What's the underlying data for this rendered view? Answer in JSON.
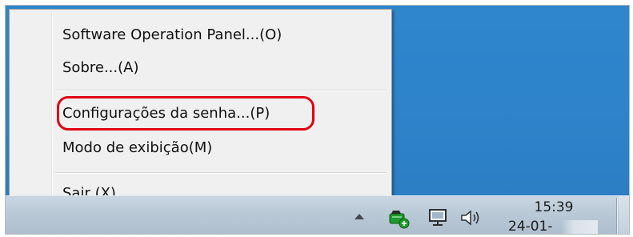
{
  "context_menu": {
    "items": [
      {
        "label": "Software Operation Panel...(O)"
      },
      {
        "label": "Sobre...(A)"
      },
      {
        "label": "Configurações da senha...(P)"
      },
      {
        "label": "Modo de exibição(M)"
      },
      {
        "label": "Sair (X)"
      }
    ],
    "highlighted_item": "Configurações da senha...(P)",
    "highlight_color": "#e00015"
  },
  "taskbar": {
    "tray_icons": [
      "show-hidden-icons-arrow",
      "scanner-icon",
      "network-icon",
      "volume-icon"
    ],
    "clock": {
      "time": "15:39",
      "date": "24-01-"
    }
  },
  "colors": {
    "desktop": "#2e83ca",
    "menu_background": "#f0f0f0",
    "taskbar": "#b9c8d6",
    "scanner_icon_green": "#1f9a2e"
  }
}
